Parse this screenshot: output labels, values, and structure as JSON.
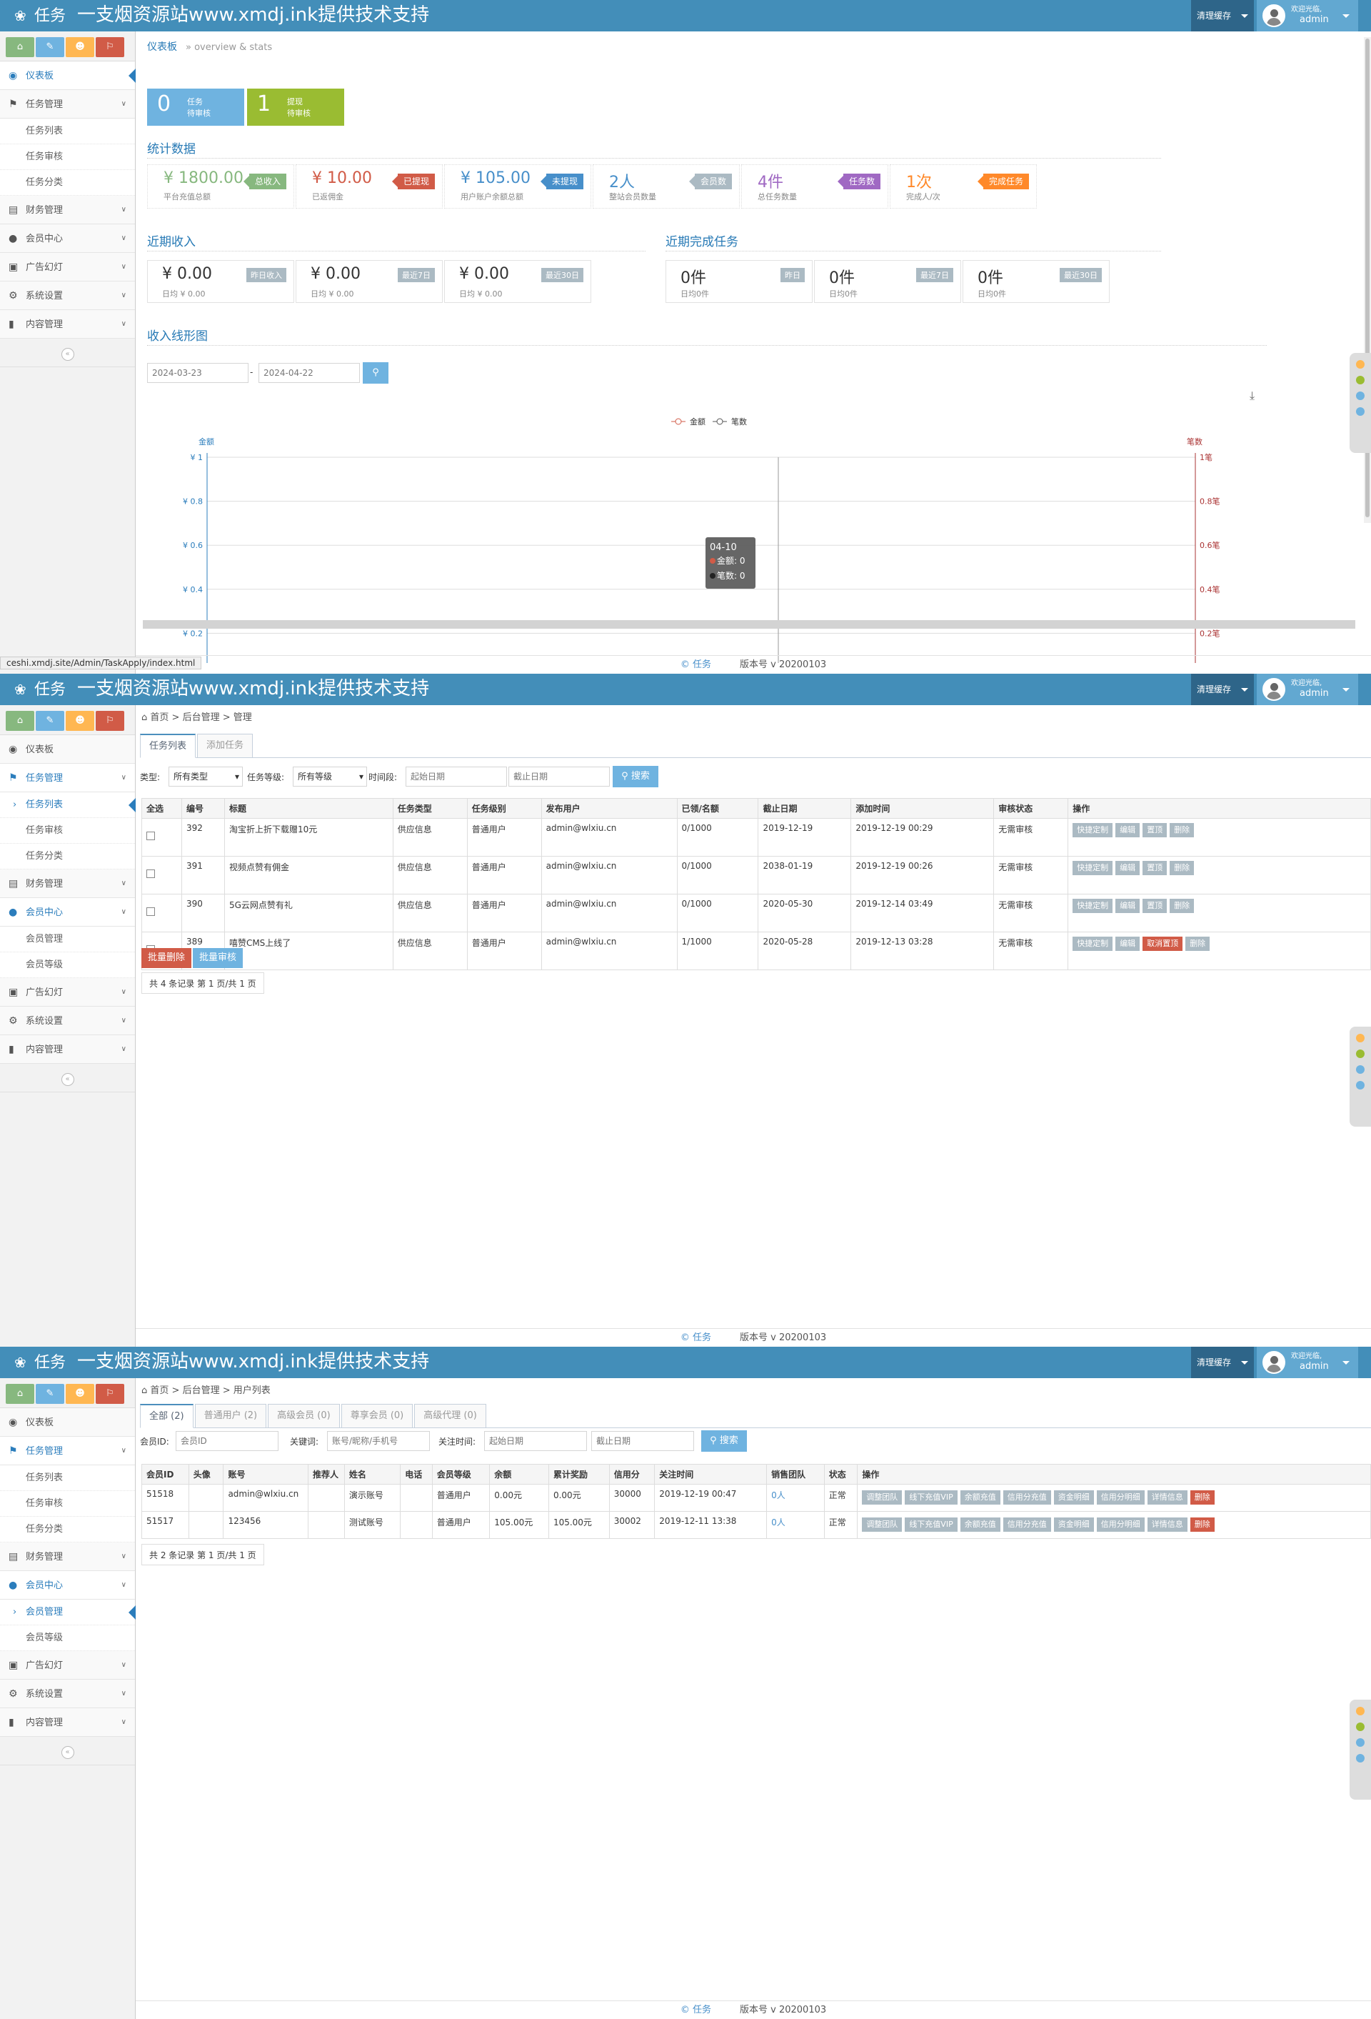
{
  "app": {
    "brand_name": "任务",
    "brand_title": "一支烟资源站www.xmdj.ink提供技术支持",
    "cache": "清理缓存",
    "welcome": "欢迎光临,",
    "user": "admin",
    "footer_copy": "© 任务",
    "footer_ver": "版本号 v 20200103",
    "status_url": "ceshi.xmdj.site/Admin/TaskApply/index.html"
  },
  "sidebar": {
    "dashboard": "仪表板",
    "task_mgmt": "任务管理",
    "task_list": "任务列表",
    "task_audit": "任务审核",
    "task_cat": "任务分类",
    "finance": "财务管理",
    "member": "会员中心",
    "member_mgmt": "会员管理",
    "member_level": "会员等级",
    "ads": "广告幻灯",
    "system": "系统设置",
    "content": "内容管理"
  },
  "dash": {
    "bc_title": "仪表板",
    "bc_desc": "» overview & stats",
    "tile1_num": "0",
    "tile1_a": "任务",
    "tile1_b": "待审核",
    "tile2_num": "1",
    "tile2_a": "提现",
    "tile2_b": "待审核",
    "stats_h": "统计数据",
    "stats": [
      {
        "v": "¥ 1800.00",
        "l": "平台充值总额",
        "tag": "总收入",
        "color": "#87b87f",
        "tagc": "#87b87f"
      },
      {
        "v": "¥ 10.00",
        "l": "已返佣金",
        "tag": "已提现",
        "color": "#d15b47",
        "tagc": "#d15b47"
      },
      {
        "v": "¥ 105.00",
        "l": "用户账户余额总额",
        "tag": "未提现",
        "color": "#478fca",
        "tagc": "#478fca"
      },
      {
        "v": "2人",
        "l": "整站会员数量",
        "tag": "会员数",
        "color": "#478fca",
        "tagc": "#abbac3"
      },
      {
        "v": "4件",
        "l": "总任务数量",
        "tag": "任务数",
        "color": "#a069c3",
        "tagc": "#a069c3"
      },
      {
        "v": "1次",
        "l": "完成人/次",
        "tag": "完成任务",
        "color": "#ff892a",
        "tagc": "#ff892a"
      }
    ],
    "income_h": "近期收入",
    "income": [
      {
        "v": "¥ 0.00",
        "l": "日均 ¥ 0.00",
        "tag": "昨日收入"
      },
      {
        "v": "¥ 0.00",
        "l": "日均 ¥ 0.00",
        "tag": "最近7日"
      },
      {
        "v": "¥ 0.00",
        "l": "日均 ¥ 0.00",
        "tag": "最近30日"
      }
    ],
    "done_h": "近期完成任务",
    "done": [
      {
        "v": "0件",
        "l": "日均0件",
        "tag": "昨日"
      },
      {
        "v": "0件",
        "l": "日均0件",
        "tag": "最近7日"
      },
      {
        "v": "0件",
        "l": "日均0件",
        "tag": "最近30日"
      }
    ],
    "chart_h": "收入线形图",
    "date_from": "2024-03-23",
    "date_to": "2024-04-22",
    "date_sep": "-",
    "legend_amount": "金额",
    "legend_count": "笔数",
    "y_left": "金额",
    "y_right": "笔数",
    "tip_date": "04-10",
    "tip_amount": "金额: 0",
    "tip_count": "笔数: 0"
  },
  "chart_data": {
    "type": "line",
    "title": "",
    "xlabel": "",
    "ylabel": "金额",
    "y_left_ticks": [
      "¥ 1",
      "¥ 0.8",
      "¥ 0.6",
      "¥ 0.4",
      "¥ 0.2"
    ],
    "y_right_ticks": [
      "1笔",
      "0.8笔",
      "0.6笔",
      "0.4笔",
      "0.2笔"
    ],
    "ylim": [
      0,
      1
    ],
    "series": [
      {
        "name": "金额",
        "color": "#d15b47",
        "values": []
      },
      {
        "name": "笔数",
        "color": "#555555",
        "values": []
      }
    ],
    "tooltip": {
      "x": "04-10",
      "金额": 0,
      "笔数": 0
    },
    "grid": true,
    "legend": "top"
  },
  "tasks": {
    "crumb": [
      "首页",
      "后台管理",
      "管理"
    ],
    "tab_list": "任务列表",
    "tab_add": "添加任务",
    "f_type": "类型:",
    "f_type_val": "所有类型",
    "f_level": "任务等级:",
    "f_level_val": "所有等级",
    "f_time": "时间段:",
    "f_start": "起始日期",
    "f_end": "截止日期",
    "search": "搜索",
    "cols": [
      "全选",
      "编号",
      "标题",
      "任务类型",
      "任务级别",
      "发布用户",
      "已领/名额",
      "截止日期",
      "添加时间",
      "审核状态",
      "操作"
    ],
    "rows": [
      {
        "id": "392",
        "title": "淘宝折上折下载赠10元",
        "type": "供应信息",
        "level": "普通用户",
        "user": "admin@wlxiu.cn",
        "quota": "0/1000",
        "end": "2019-12-19",
        "add": "2019-12-19 00:29",
        "status": "无需审核"
      },
      {
        "id": "391",
        "title": "视频点赞有佣金",
        "type": "供应信息",
        "level": "普通用户",
        "user": "admin@wlxiu.cn",
        "quota": "0/1000",
        "end": "2038-01-19",
        "add": "2019-12-19 00:26",
        "status": "无需审核"
      },
      {
        "id": "390",
        "title": "5G云网点赞有礼",
        "type": "供应信息",
        "level": "普通用户",
        "user": "admin@wlxiu.cn",
        "quota": "0/1000",
        "end": "2020-05-30",
        "add": "2019-12-14 03:49",
        "status": "无需审核"
      },
      {
        "id": "389",
        "title": "嘻赞CMS上线了",
        "type": "供应信息",
        "level": "普通用户",
        "user": "admin@wlxiu.cn",
        "quota": "1/1000",
        "end": "2020-05-28",
        "add": "2019-12-13 03:28",
        "status": "无需审核"
      }
    ],
    "ops": [
      "快捷定制",
      "编辑",
      "置顶",
      "删除"
    ],
    "op_hot": "取消置顶",
    "batch_del": "批量删除",
    "batch_audit": "批量审核",
    "pager": "共 4 条记录 第 1 页/共 1 页"
  },
  "users": {
    "crumb": [
      "首页",
      "后台管理",
      "用户列表"
    ],
    "tabs": [
      "全部 (2)",
      "普通用户 (2)",
      "高级会员 (0)",
      "尊享会员 (0)",
      "高级代理 (0)"
    ],
    "f_id": "会员ID:",
    "f_id_ph": "会员ID",
    "f_kw": "关键词:",
    "f_kw_ph": "账号/昵称/手机号",
    "f_time": "关注时间:",
    "f_start": "起始日期",
    "f_end": "截止日期",
    "search": "搜索",
    "cols": [
      "会员ID",
      "头像",
      "账号",
      "推荐人",
      "姓名",
      "电话",
      "会员等级",
      "余额",
      "累计奖励",
      "信用分",
      "关注时间",
      "销售团队",
      "状态",
      "操作"
    ],
    "rows": [
      {
        "id": "51518",
        "acc": "admin@wlxiu.cn",
        "name": "演示账号",
        "level": "普通用户",
        "bal": "0.00元",
        "reward": "0.00元",
        "credit": "30000",
        "time": "2019-12-19 00:47",
        "team": "0人",
        "status": "正常"
      },
      {
        "id": "51517",
        "acc": "123456",
        "name": "测试账号",
        "level": "普通用户",
        "bal": "105.00元",
        "reward": "105.00元",
        "credit": "30002",
        "time": "2019-12-11 13:38",
        "team": "0人",
        "status": "正常"
      }
    ],
    "ops": [
      "调整团队",
      "线下充值VIP",
      "余额充值",
      "信用分充值",
      "资金明细",
      "信用分明细",
      "详情信息",
      "删除"
    ],
    "pager": "共 2 条记录 第 1 页/共 1 页"
  }
}
